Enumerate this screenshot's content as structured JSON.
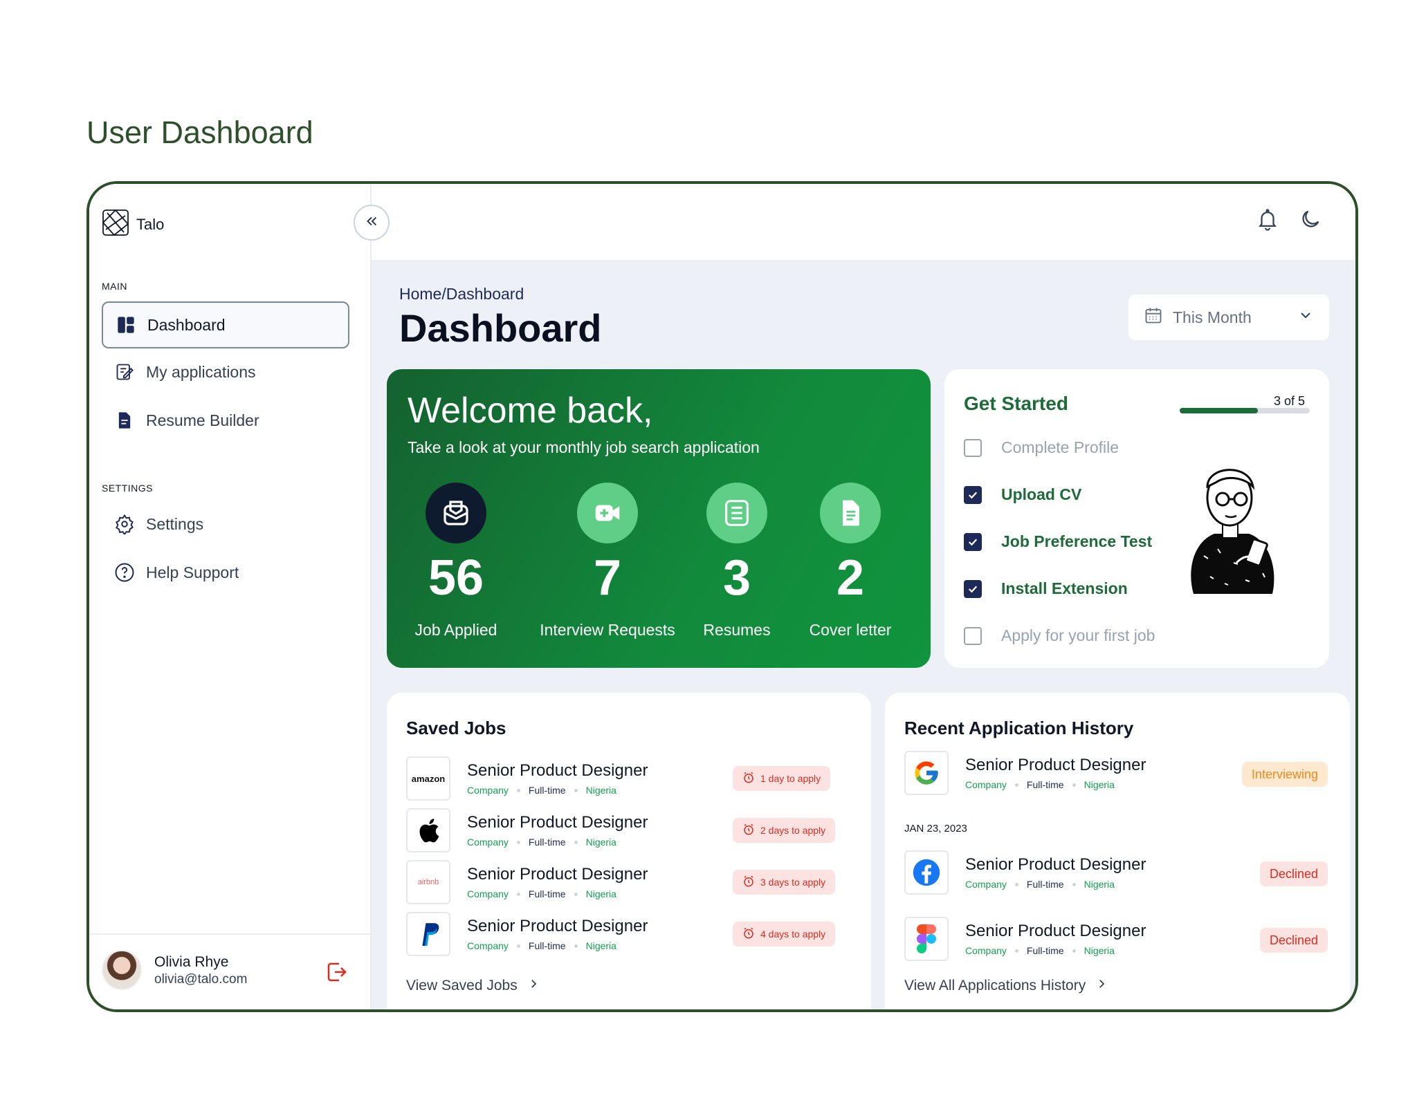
{
  "page_title": "User Dashboard",
  "brand": {
    "name": "Talo"
  },
  "sidebar": {
    "main_label": "MAIN",
    "settings_label": "SETTINGS",
    "items": [
      {
        "label": "Dashboard",
        "icon": "dashboard-icon",
        "active": true
      },
      {
        "label": "My applications",
        "icon": "edit-note-icon"
      },
      {
        "label": "Resume Builder",
        "icon": "document-icon"
      },
      {
        "label": "Settings",
        "icon": "gear-icon"
      },
      {
        "label": "Help Support",
        "icon": "help-icon"
      }
    ]
  },
  "user": {
    "name": "Olivia Rhye",
    "email": "olivia@talo.com"
  },
  "header": {
    "breadcrumb": "Home/Dashboard",
    "title": "Dashboard",
    "period": "This Month"
  },
  "welcome": {
    "heading": "Welcome back,",
    "subheading": "Take a look at your monthly job search application",
    "stats": [
      {
        "value": "56",
        "label": "Job Applied",
        "icon": "inbox-icon"
      },
      {
        "value": "7",
        "label": "Interview Requests",
        "icon": "video-icon"
      },
      {
        "value": "3",
        "label": "Resumes",
        "icon": "list-icon"
      },
      {
        "value": "2",
        "label": "Cover letter",
        "icon": "file-icon"
      }
    ]
  },
  "get_started": {
    "title": "Get Started",
    "progress_label": "3 of 5",
    "progress": 0.6,
    "tasks": [
      {
        "label": "Complete Profile",
        "done": false
      },
      {
        "label": "Upload CV",
        "done": true
      },
      {
        "label": "Job Preference Test",
        "done": true
      },
      {
        "label": "Install Extension",
        "done": true
      },
      {
        "label": "Apply for your first job",
        "done": false
      }
    ]
  },
  "saved_jobs": {
    "title": "Saved Jobs",
    "link": "View Saved Jobs",
    "items": [
      {
        "logo": "amazon",
        "title": "Senior Product Designer",
        "company": "Company",
        "type": "Full-time",
        "location": "Nigeria",
        "deadline": "1 day to apply"
      },
      {
        "logo": "apple-icon",
        "title": "Senior Product Designer",
        "company": "Company",
        "type": "Full-time",
        "location": "Nigeria",
        "deadline": "2 days to apply"
      },
      {
        "logo": "airbnb",
        "title": "Senior Product Designer",
        "company": "Company",
        "type": "Full-time",
        "location": "Nigeria",
        "deadline": "3 days to apply"
      },
      {
        "logo": "paypal-icon",
        "title": "Senior Product Designer",
        "company": "Company",
        "type": "Full-time",
        "location": "Nigeria",
        "deadline": "4 days to apply"
      }
    ]
  },
  "history": {
    "title": "Recent Application History",
    "link": "View All Applications History",
    "date_label": "JAN  23, 2023",
    "items": [
      {
        "logo": "google-icon",
        "title": "Senior Product Designer",
        "company": "Company",
        "type": "Full-time",
        "location": "Nigeria",
        "status": "Interviewing"
      },
      {
        "logo": "facebook-icon",
        "title": "Senior Product Designer",
        "company": "Company",
        "type": "Full-time",
        "location": "Nigeria",
        "status": "Declined"
      },
      {
        "logo": "figma-icon",
        "title": "Senior Product Designer",
        "company": "Company",
        "type": "Full-time",
        "location": "Nigeria",
        "status": "Declined"
      }
    ]
  },
  "colors": {
    "brand_green": "#1d6b38",
    "frame_green": "#2d4f2a",
    "navy": "#1d2a57",
    "declined_red": "#d92d20",
    "interviewing_orange": "#f08a1c"
  }
}
